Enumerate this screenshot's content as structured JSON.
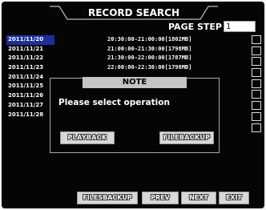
{
  "title": "RECORD SEARCH",
  "page_step": {
    "label": "PAGE STEP",
    "value": "1"
  },
  "dates": [
    "2011/11/20",
    "2011/11/21",
    "2011/11/22",
    "2011/11/23",
    "2011/11/24",
    "2011/11/25",
    "2011/11/26",
    "2011/11/27",
    "2011/11/28"
  ],
  "selected_date_index": 0,
  "records": [
    "20:30:00-21:00:00[1802MB]",
    "21:00:00-21:30:00[1798MB]",
    "21:30:00-22:00:00[1787MB]",
    "22:00:00-22:30:00[1798MB]"
  ],
  "dialog": {
    "title": "NOTE",
    "message": "Please select operation",
    "playback_label": "PLAYBACK",
    "filebackup_label": "FILEBACKUP"
  },
  "buttons": {
    "filebackup": "FILESBACKUP",
    "prev": "PREV",
    "next": "NEXT",
    "exit": "EXIT"
  },
  "colors": {
    "selection": "#1c2f9a",
    "background": "#050505",
    "button": "#d8d8d8"
  }
}
